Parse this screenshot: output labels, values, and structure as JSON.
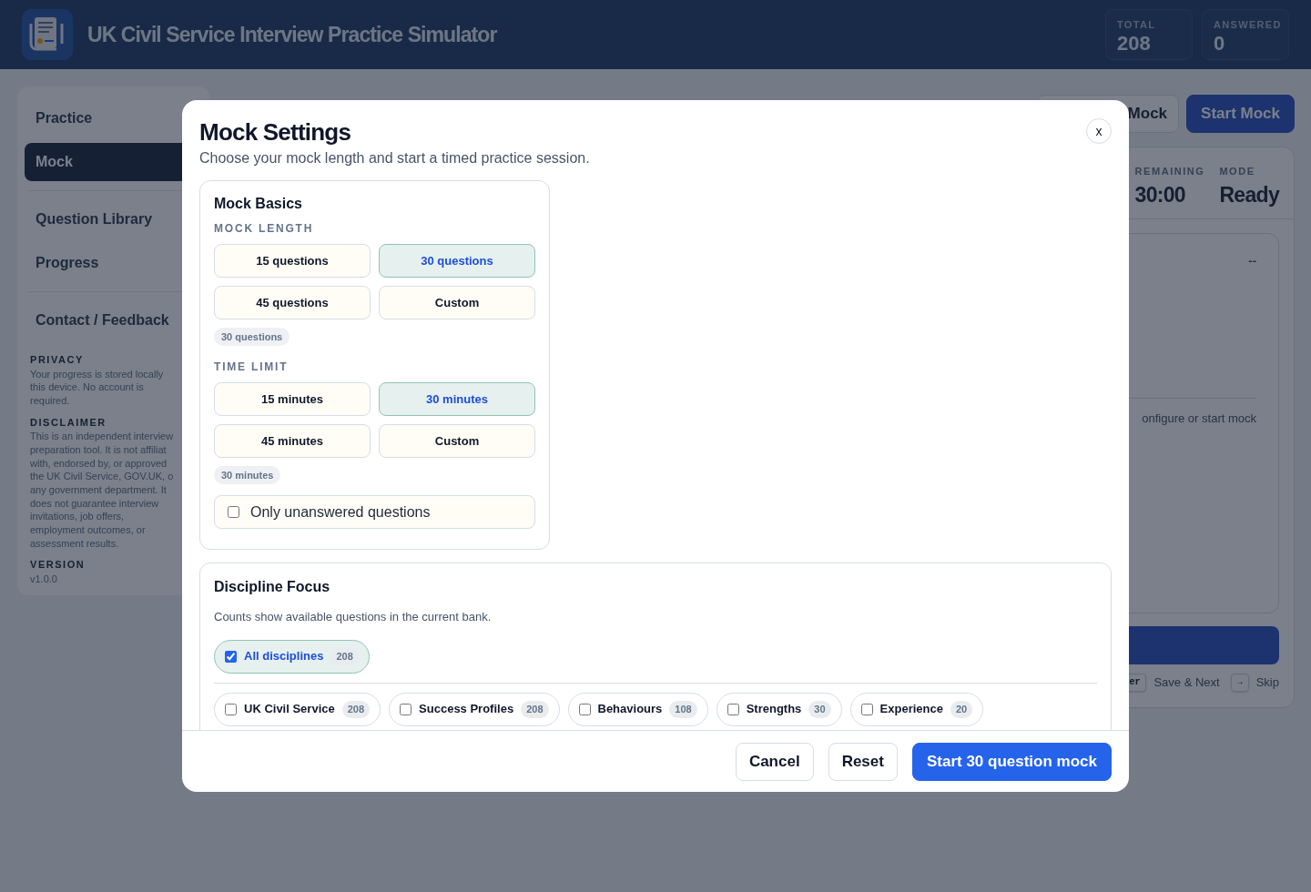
{
  "header": {
    "title": "UK Civil Service Interview Practice Simulator",
    "stats": [
      {
        "label": "TOTAL",
        "value": "208"
      },
      {
        "label": "ANSWERED",
        "value": "0"
      }
    ]
  },
  "sidebar": {
    "nav": [
      {
        "label": "Practice",
        "selected": false
      },
      {
        "label": "Mock",
        "selected": true
      },
      {
        "label": "Question Library",
        "selected": false
      },
      {
        "label": "Progress",
        "selected": false
      },
      {
        "label": "Contact / Feedback",
        "selected": false
      }
    ],
    "info": [
      {
        "heading": "PRIVACY",
        "lines": [
          "Your progress is stored locally",
          "this device. No account is",
          "required."
        ]
      },
      {
        "heading": "DISCLAIMER",
        "lines": [
          "This is an independent interview",
          "preparation tool. It is not affiliat",
          "with, endorsed by, or approved",
          "the UK Civil Service, GOV.UK, o",
          "any government department. It",
          "does not guarantee interview",
          "invitations, job offers,",
          "employment outcomes, or",
          "assessment results."
        ]
      },
      {
        "heading": "VERSION",
        "lines": [
          "v1.0.0"
        ]
      }
    ]
  },
  "main": {
    "buttons": [
      {
        "label": "Mock",
        "kind": "secondary"
      },
      {
        "label": "Start Mock",
        "kind": "primary"
      }
    ],
    "stats": [
      {
        "label": "REMAINING",
        "value": "30:00"
      },
      {
        "label": "MODE",
        "value": "Ready"
      }
    ],
    "card": {
      "badge": "--",
      "status": "onfigure or start mock"
    },
    "shortcuts": [
      {
        "key": "er",
        "label": "Save & Next"
      },
      {
        "key": "→",
        "label": "Skip"
      }
    ]
  },
  "modal": {
    "title": "Mock Settings",
    "subtitle": "Choose your mock length and start a timed practice session.",
    "close": "x",
    "basics": {
      "title": "Mock Basics",
      "groups": [
        {
          "label": "MOCK LENGTH",
          "summary": "30 questions",
          "options": [
            {
              "label": "15 questions",
              "selected": false
            },
            {
              "label": "30 questions",
              "selected": true
            },
            {
              "label": "45 questions",
              "selected": false
            },
            {
              "label": "Custom",
              "selected": false
            }
          ]
        },
        {
          "label": "TIME LIMIT",
          "summary": "30 minutes",
          "options": [
            {
              "label": "15 minutes",
              "selected": false
            },
            {
              "label": "30 minutes",
              "selected": true
            },
            {
              "label": "45 minutes",
              "selected": false
            },
            {
              "label": "Custom",
              "selected": false
            }
          ]
        }
      ],
      "only_unanswered": {
        "label": "Only unanswered questions",
        "checked": false
      }
    },
    "discipline": {
      "title": "Discipline Focus",
      "note": "Counts show available questions in the current bank.",
      "all": {
        "label": "All disciplines",
        "count": "208",
        "checked": true
      },
      "items": [
        {
          "label": "UK Civil Service",
          "count": "208",
          "checked": false
        },
        {
          "label": "Success Profiles",
          "count": "208",
          "checked": false
        },
        {
          "label": "Behaviours",
          "count": "108",
          "checked": false
        },
        {
          "label": "Strengths",
          "count": "30",
          "checked": false
        },
        {
          "label": "Experience",
          "count": "20",
          "checked": false
        }
      ]
    },
    "actions": [
      {
        "label": "Cancel",
        "kind": "secondary"
      },
      {
        "label": "Reset",
        "kind": "secondary"
      },
      {
        "label": "Start 30 question mock",
        "kind": "primary"
      }
    ]
  }
}
